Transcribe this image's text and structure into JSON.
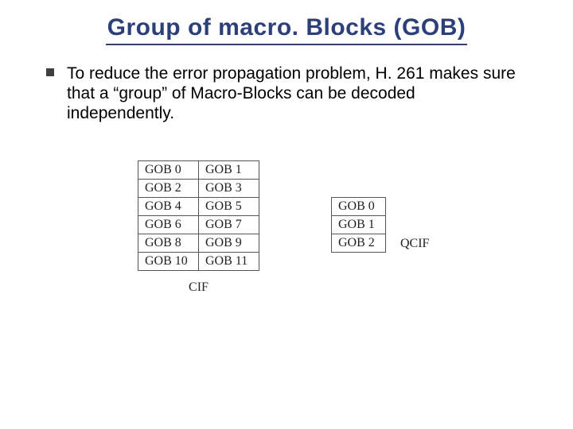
{
  "title": "Group of macro. Blocks (GOB)",
  "bullet": "To reduce the error propagation problem, H. 261 makes sure that a “group” of Macro-Blocks can be decoded independently.",
  "cif": {
    "caption": "CIF",
    "rows": [
      [
        "GOB 0",
        "GOB 1"
      ],
      [
        "GOB 2",
        "GOB 3"
      ],
      [
        "GOB 4",
        "GOB 5"
      ],
      [
        "GOB 6",
        "GOB 7"
      ],
      [
        "GOB 8",
        "GOB 9"
      ],
      [
        "GOB 10",
        "GOB 11"
      ]
    ]
  },
  "qcif": {
    "caption": "QCIF",
    "rows": [
      [
        "GOB 0"
      ],
      [
        "GOB 1"
      ],
      [
        "GOB 2"
      ]
    ]
  }
}
